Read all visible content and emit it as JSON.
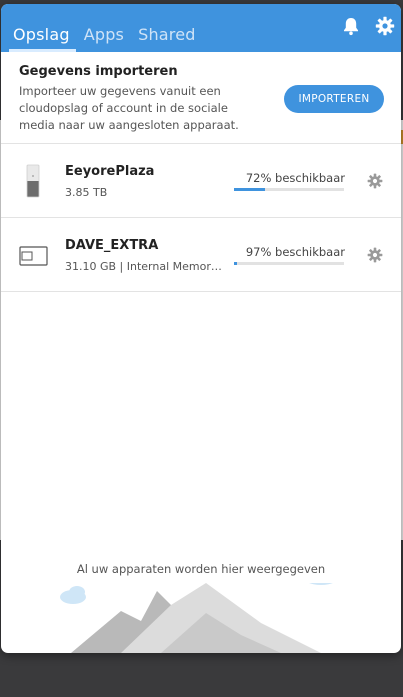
{
  "tabs": [
    {
      "label": "Opslag",
      "active": true
    },
    {
      "label": "Apps",
      "active": false
    },
    {
      "label": "Shared",
      "active": false
    }
  ],
  "top_icons": [
    "bell-icon",
    "gear-icon"
  ],
  "import": {
    "title": "Gegevens importeren",
    "description": "Importeer uw gegevens vanuit een cloudopslag of account in de sociale media naar uw aangesloten apparaat.",
    "button_label": "IMPORTEREN"
  },
  "devices": [
    {
      "name": "EeyorePlaza",
      "meta": "3.85 TB",
      "availability": "72% beschikbaar",
      "used_fraction": 0.28,
      "icon": "nas-drive-icon"
    },
    {
      "name": "DAVE_EXTRA",
      "meta": "31.10 GB | Internal Memory...",
      "availability": "97% beschikbaar",
      "used_fraction": 0.03,
      "icon": "external-drive-icon"
    }
  ],
  "empty_note": "Al uw apparaten worden hier weergegeven",
  "colors": {
    "accent": "#3f93de",
    "background": "#ffffff",
    "divider": "#e3e3e3"
  }
}
